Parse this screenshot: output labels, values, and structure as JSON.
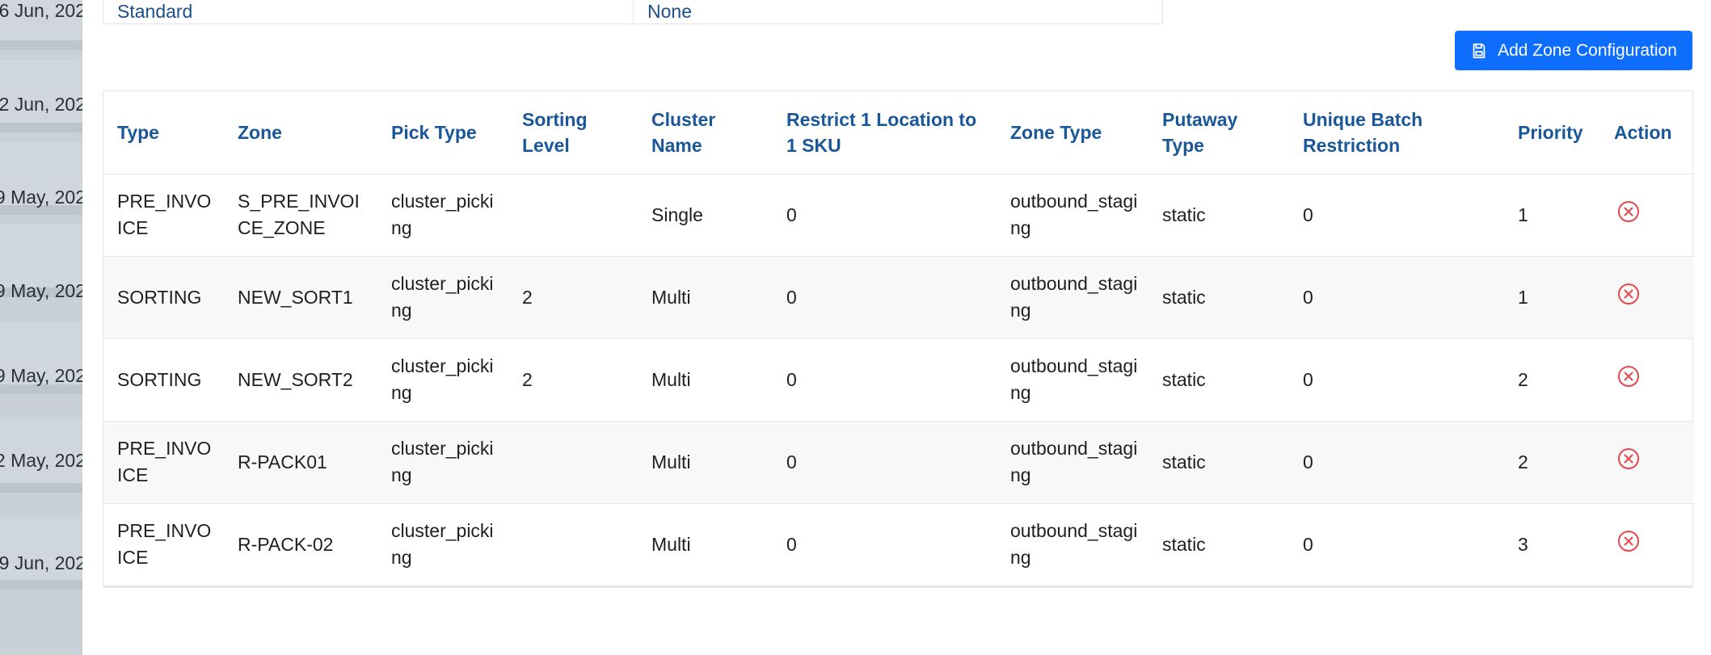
{
  "background_dates": [
    "6 Jun, 202",
    "2 Jun, 202",
    "9 May, 202",
    "9 May, 202",
    "9 May, 202",
    "2 May, 202",
    "9 Jun, 202"
  ],
  "info_card": {
    "left_value": "Standard",
    "right_value": "None"
  },
  "add_button": {
    "label": "Add Zone Configuration",
    "icon": "save-icon",
    "color": "#0d6efd"
  },
  "table": {
    "headers": [
      "Type",
      "Zone",
      "Pick Type",
      "Sorting Level",
      "Cluster Name",
      "Restrict 1 Location to 1 SKU",
      "Zone Type",
      "Putaway Type",
      "Unique Batch Restriction",
      "Priority",
      "Action"
    ],
    "rows": [
      {
        "type": "PRE_INVOICE",
        "zone": "S_PRE_INVOICE_ZONE",
        "pick_type": "cluster_picking",
        "sorting_level": "",
        "cluster_name": "Single",
        "restrict": "0",
        "zone_type": "outbound_staging",
        "putaway_type": "static",
        "unique_batch": "0",
        "priority": "1"
      },
      {
        "type": "SORTING",
        "zone": "NEW_SORT1",
        "pick_type": "cluster_picking",
        "sorting_level": "2",
        "cluster_name": "Multi",
        "restrict": "0",
        "zone_type": "outbound_staging",
        "putaway_type": "static",
        "unique_batch": "0",
        "priority": "1"
      },
      {
        "type": "SORTING",
        "zone": "NEW_SORT2",
        "pick_type": "cluster_picking",
        "sorting_level": "2",
        "cluster_name": "Multi",
        "restrict": "0",
        "zone_type": "outbound_staging",
        "putaway_type": "static",
        "unique_batch": "0",
        "priority": "2"
      },
      {
        "type": "PRE_INVOICE",
        "zone": "R-PACK01",
        "pick_type": "cluster_picking",
        "sorting_level": "",
        "cluster_name": "Multi",
        "restrict": "0",
        "zone_type": "outbound_staging",
        "putaway_type": "static",
        "unique_batch": "0",
        "priority": "2"
      },
      {
        "type": "PRE_INVOICE",
        "zone": "R-PACK-02",
        "pick_type": "cluster_picking",
        "sorting_level": "",
        "cluster_name": "Multi",
        "restrict": "0",
        "zone_type": "outbound_staging",
        "putaway_type": "static",
        "unique_batch": "0",
        "priority": "3"
      }
    ],
    "action_icon": "remove-circle-icon",
    "action_color": "#e5484d"
  }
}
